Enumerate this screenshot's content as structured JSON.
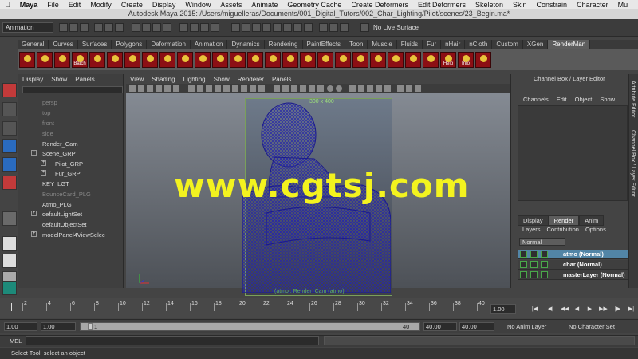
{
  "menubar": {
    "apple": "",
    "app": "Maya",
    "items": [
      "File",
      "Edit",
      "Modify",
      "Create",
      "Display",
      "Window",
      "Assets",
      "Animate",
      "Geometry Cache",
      "Create Deformers",
      "Edit Deformers",
      "Skeleton",
      "Skin",
      "Constrain",
      "Character",
      "Mu"
    ]
  },
  "window": {
    "title": "Autodesk Maya 2015: /Users/miguelleras/Documents/001_Digital_Tutors/002_Char_Lighting/Pilot/scenes/23_Begin.ma*"
  },
  "statusline": {
    "mode": "Animation",
    "live_surface": "No Live Surface"
  },
  "shelf": {
    "tabs": [
      "General",
      "Curves",
      "Surfaces",
      "Polygons",
      "Deformation",
      "Animation",
      "Dynamics",
      "Rendering",
      "PaintEffects",
      "Toon",
      "Muscle",
      "Fluids",
      "Fur",
      "nHair",
      "nCloth",
      "Custom",
      "XGen",
      "RenderMan"
    ],
    "active_tab": "RenderMan",
    "icon_labels": [
      "",
      "",
      "",
      "Batch",
      "",
      "",
      "",
      "",
      "",
      "",
      "",
      "",
      "",
      "",
      "",
      "",
      "",
      "",
      "",
      "",
      "",
      "",
      "",
      "",
      "Help",
      "Info",
      ""
    ]
  },
  "outliner": {
    "menu": [
      "Display",
      "Show",
      "Panels"
    ],
    "items": [
      {
        "label": "persp",
        "dim": true
      },
      {
        "label": "top",
        "dim": true
      },
      {
        "label": "front",
        "dim": true
      },
      {
        "label": "side",
        "dim": true
      },
      {
        "label": "Render_Cam",
        "dim": false
      },
      {
        "label": "Scene_GRP",
        "dim": false
      },
      {
        "label": "Pilot_GRP",
        "dim": false
      },
      {
        "label": "Fur_GRP",
        "dim": false
      },
      {
        "label": "KEY_LGT",
        "dim": false
      },
      {
        "label": "BounceCard_PLG",
        "dim": true
      },
      {
        "label": "Atmo_PLG",
        "dim": false
      },
      {
        "label": "defaultLightSet",
        "dim": false
      },
      {
        "label": "defaultObjectSet",
        "dim": false
      },
      {
        "label": "modelPanel4ViewSelec",
        "dim": false
      }
    ]
  },
  "viewport": {
    "menu": [
      "View",
      "Shading",
      "Lighting",
      "Show",
      "Renderer",
      "Panels"
    ],
    "resolution": "300 x 400",
    "camera_label": "(atmo : Render_Cam (atmo)",
    "watermark": "www.cgtsj.com"
  },
  "channelbox": {
    "title": "Channel Box / Layer Editor",
    "menu": [
      "Channels",
      "Edit",
      "Object",
      "Show"
    ],
    "tabs": [
      "Display",
      "Render",
      "Anim"
    ],
    "active_tab": "Render",
    "submenu": [
      "Layers",
      "Contribution",
      "Options"
    ],
    "blend_mode": "Normal",
    "layers": [
      {
        "name": "atmo (Normal)",
        "selected": true
      },
      {
        "name": "char (Normal)",
        "selected": false
      },
      {
        "name": "masterLayer (Normal)",
        "selected": false
      }
    ],
    "side_tabs": [
      "Attribute Editor",
      "Channel Box / Layer Editor"
    ]
  },
  "timeslider": {
    "ticks": [
      "2",
      "4",
      "6",
      "8",
      "10",
      "12",
      "14",
      "16",
      "18",
      "20",
      "22",
      "24",
      "26",
      "28",
      "30",
      "32",
      "34",
      "36",
      "38",
      "40"
    ],
    "current_frame": "1.00"
  },
  "rangeslider": {
    "start": "1.00",
    "anim_start": "1.00",
    "range_start": "1",
    "range_end": "40",
    "anim_end": "40.00",
    "end": "40.00",
    "anim_layer": "No Anim Layer",
    "character_set": "No Character Set"
  },
  "commandline": {
    "label": "MEL",
    "help": "Select Tool: select an object"
  }
}
